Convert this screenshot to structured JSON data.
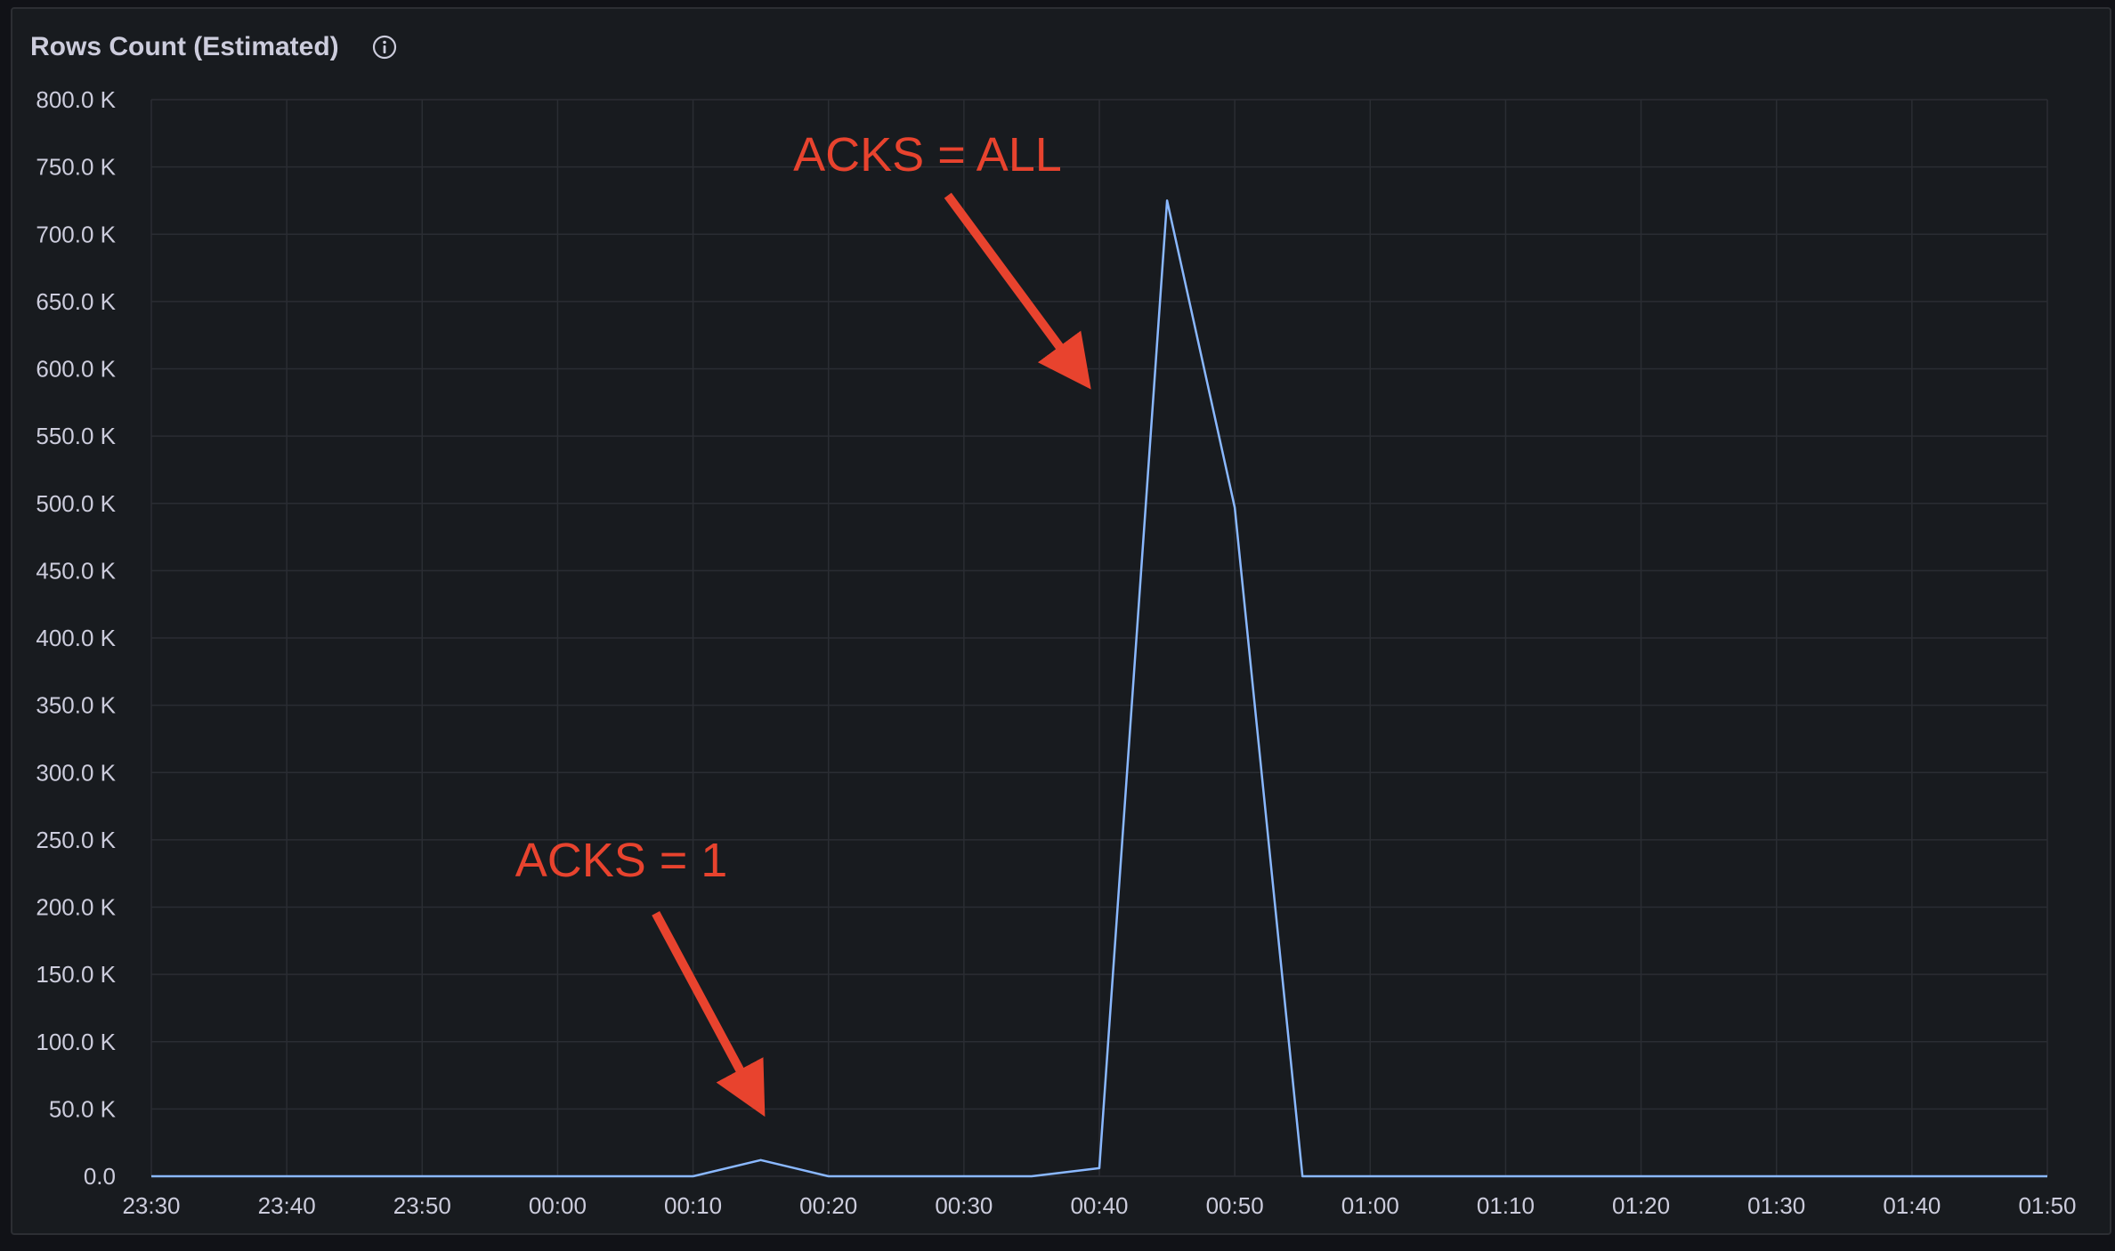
{
  "panel": {
    "title": "Rows Count (Estimated)",
    "info_icon": "info-circle-icon"
  },
  "colors": {
    "background": "#181b1f",
    "grid": "#2a2d33",
    "series": "#8ab8ff",
    "annotation": "#e8432e",
    "text": "#ccccdc"
  },
  "chart_data": {
    "type": "line",
    "title": "Rows Count (Estimated)",
    "xlabel": "",
    "ylabel": "",
    "grid": true,
    "x_ticks": [
      "23:30",
      "23:40",
      "23:50",
      "00:00",
      "00:10",
      "00:20",
      "00:30",
      "00:40",
      "00:50",
      "01:00",
      "01:10",
      "01:20",
      "01:30",
      "01:40",
      "01:50"
    ],
    "y_ticks": [
      "0.0",
      "50.0 K",
      "100.0 K",
      "150.0 K",
      "200.0 K",
      "250.0 K",
      "300.0 K",
      "350.0 K",
      "400.0 K",
      "450.0 K",
      "500.0 K",
      "550.0 K",
      "600.0 K",
      "650.0 K",
      "700.0 K",
      "750.0 K",
      "800.0 K"
    ],
    "ylim": [
      0,
      800000
    ],
    "xlim": [
      "23:30",
      "01:50"
    ],
    "series": [
      {
        "x": [
          "23:30",
          "00:10",
          "00:15",
          "00:20",
          "00:35",
          "00:40",
          "00:45",
          "00:50",
          "00:55",
          "01:50"
        ],
        "values": [
          0,
          0,
          12000,
          0,
          0,
          6000,
          725000,
          497000,
          0,
          0
        ]
      }
    ],
    "annotations": [
      {
        "text": "ACKS = ALL",
        "points_to": {
          "x": "00:39",
          "y": 590000
        }
      },
      {
        "text": "ACKS = 1",
        "points_to": {
          "x": "00:15",
          "y": 50000
        }
      }
    ]
  }
}
